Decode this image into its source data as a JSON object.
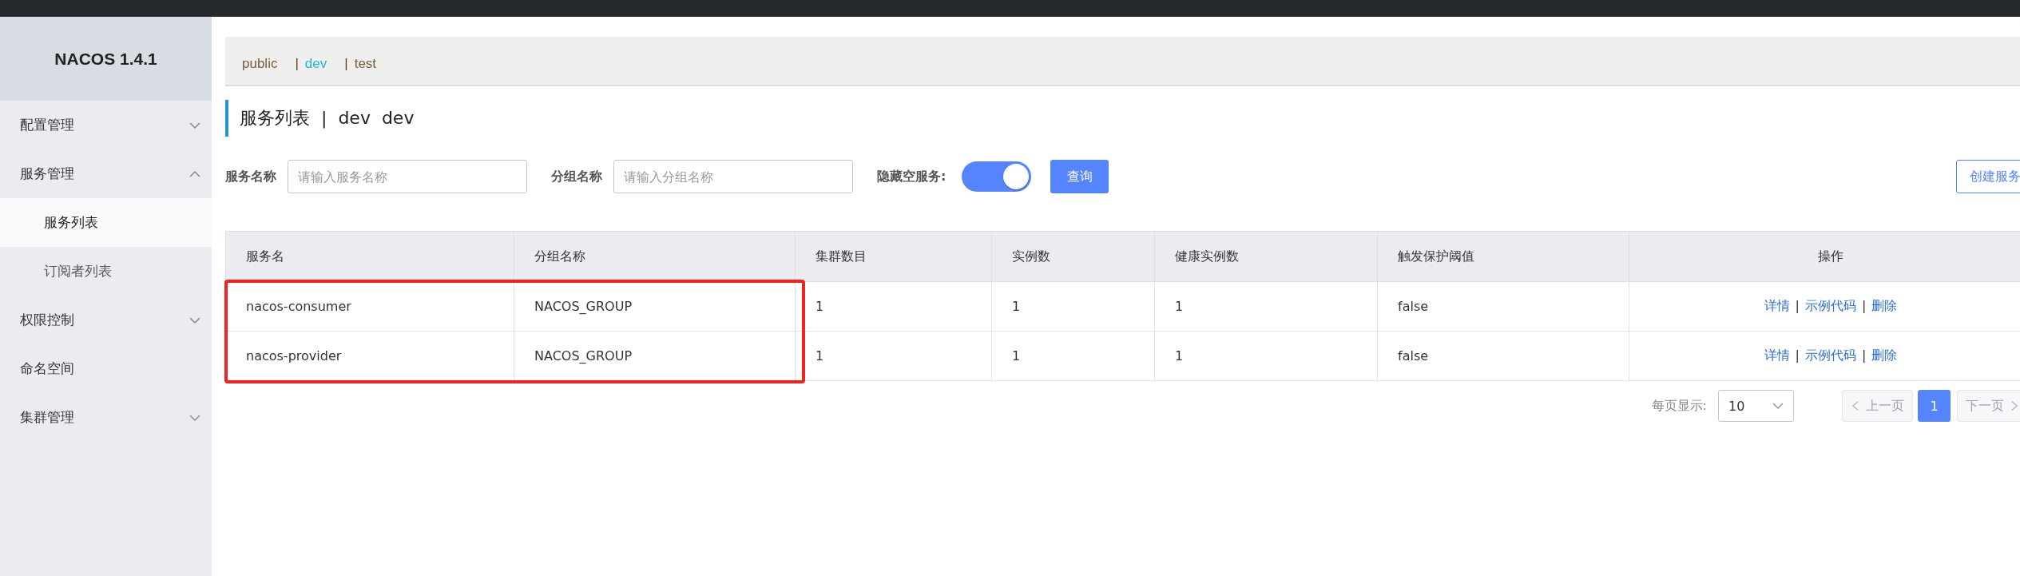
{
  "sidebar": {
    "title": "NACOS 1.4.1",
    "items": [
      {
        "label": "配置管理",
        "expanded": false,
        "selected": false
      },
      {
        "label": "服务管理",
        "expanded": true,
        "selected": false,
        "children": [
          {
            "label": "服务列表",
            "selected": true
          },
          {
            "label": "订阅者列表",
            "selected": false
          }
        ]
      },
      {
        "label": "权限控制",
        "expanded": false,
        "selected": false
      },
      {
        "label": "命名空间",
        "selected": false
      },
      {
        "label": "集群管理",
        "expanded": false,
        "selected": false
      }
    ]
  },
  "namespaces": [
    {
      "label": "public",
      "selected": false
    },
    {
      "separator": "|",
      "label": "dev",
      "selected": true
    },
    {
      "separator": "|",
      "label": "test",
      "selected": false
    }
  ],
  "page_title": "服务列表  |  dev  dev",
  "filters": {
    "service_label": "服务名称",
    "service_placeholder": "请输入服务名称",
    "group_label": "分组名称",
    "group_placeholder": "请输入分组名称",
    "hide_empty_label": "隐藏空服务:",
    "hide_empty_on": true,
    "query_button": "查询",
    "create_button": "创建服务"
  },
  "table": {
    "columns": [
      {
        "label": "服务名",
        "highlighted": true
      },
      {
        "label": "分组名称",
        "highlighted": true
      },
      {
        "label": "集群数目",
        "highlighted": false
      },
      {
        "label": "实例数",
        "highlighted": false
      },
      {
        "label": "健康实例数",
        "highlighted": false
      },
      {
        "label": "触发保护阈值",
        "highlighted": false
      },
      {
        "label": "操作",
        "highlighted": false
      }
    ],
    "rows": [
      {
        "highlighted": true,
        "cells": [
          "nacos-consumer",
          "NACOS_GROUP",
          "1",
          "1",
          "1",
          "false"
        ],
        "actions": [
          {
            "kind": "link",
            "text": "详情"
          },
          {
            "kind": "separator",
            "text": "|"
          },
          {
            "kind": "link",
            "text": "示例代码"
          },
          {
            "kind": "separator",
            "text": "|"
          },
          {
            "kind": "link",
            "text": "删除"
          }
        ]
      },
      {
        "highlighted": true,
        "cells": [
          "nacos-provider",
          "NACOS_GROUP",
          "1",
          "1",
          "1",
          "false"
        ],
        "actions": [
          {
            "kind": "link",
            "text": "详情"
          },
          {
            "kind": "separator",
            "text": "|"
          },
          {
            "kind": "link",
            "text": "示例代码"
          },
          {
            "kind": "separator",
            "text": "|"
          },
          {
            "kind": "link",
            "text": "删除"
          }
        ]
      }
    ]
  },
  "pagination": {
    "page_size_label": "每页显示:",
    "page_size": "10",
    "prev": {
      "label": "上一页",
      "disabled": true
    },
    "pages": [
      {
        "label": "1",
        "selected": true
      }
    ],
    "next": {
      "label": "下一页",
      "disabled": true
    }
  }
}
